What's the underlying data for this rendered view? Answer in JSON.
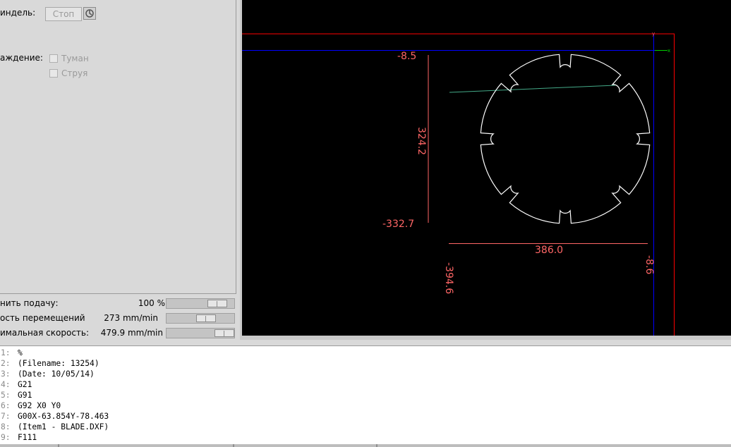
{
  "spindle": {
    "label": "индель:",
    "value": "Стоп"
  },
  "coolant": {
    "label": "аждение:",
    "mist": "Туман",
    "flood": "Струя"
  },
  "sliders": [
    {
      "label": "нить подачу:",
      "value": "100 %",
      "level": 0.62
    },
    {
      "label": "ость перемещений",
      "value": "273 mm/min",
      "level": 0.42
    },
    {
      "label": "имальная скорость:",
      "value": "479.9 mm/min",
      "level": 0.72
    }
  ],
  "preview": {
    "dims": {
      "top_left": "-8.5",
      "height": "324.2",
      "bottom_left": "-332.7",
      "width": "386.0",
      "left_bottom": "-394.6",
      "right_bottom": "-8.6"
    },
    "axis_x": "x",
    "axis_y": "y",
    "colors": {
      "limits": "#ff0000",
      "axis_line": "#0000ff",
      "dims": "#ff6666",
      "path": "#ffffff",
      "rapid": "#44aa88"
    }
  },
  "code": [
    {
      "n": "1:",
      "t": "%"
    },
    {
      "n": "2:",
      "t": "(Filename: 13254)"
    },
    {
      "n": "3:",
      "t": "(Date: 10/05/14)"
    },
    {
      "n": "4:",
      "t": "G21"
    },
    {
      "n": "5:",
      "t": "G91"
    },
    {
      "n": "6:",
      "t": "G92 X0 Y0"
    },
    {
      "n": "7:",
      "t": "G00X-63.854Y-78.463"
    },
    {
      "n": "8:",
      "t": "(Item1 - BLADE.DXF)"
    },
    {
      "n": "9:",
      "t": "F111"
    }
  ]
}
